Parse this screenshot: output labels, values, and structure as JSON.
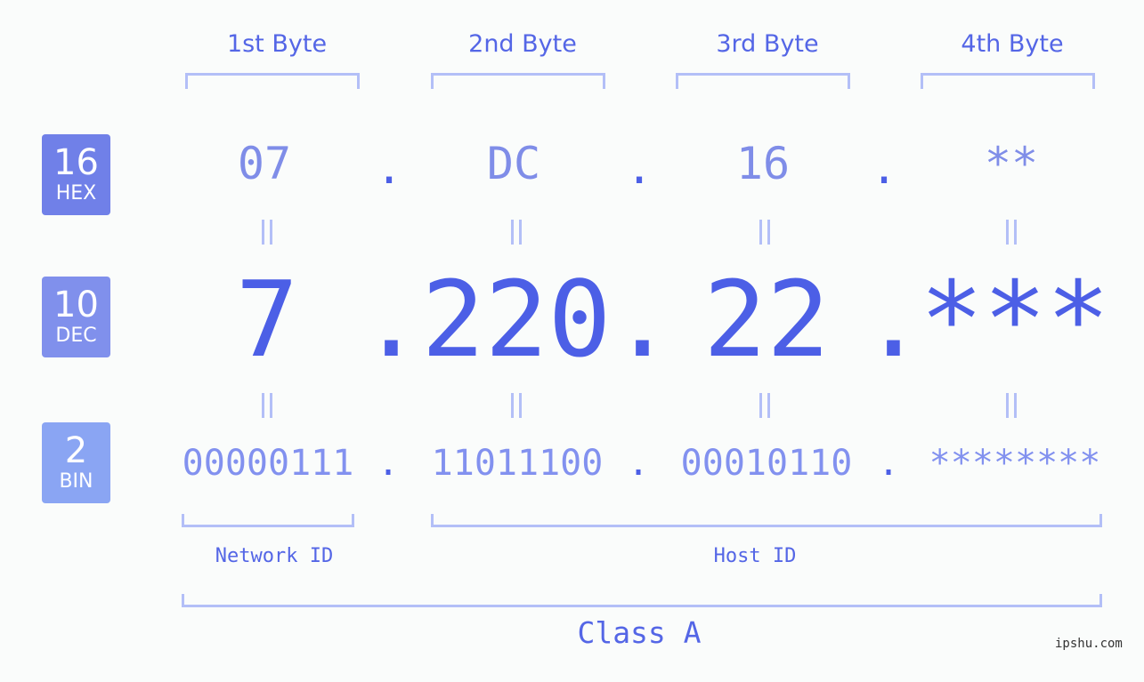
{
  "colors": {
    "accent": "#4c5fe6",
    "hex_badge": "#7080e8",
    "dec_badge": "#8090ec",
    "bin_badge": "#8aa5f3",
    "bracket": "#b3bff7"
  },
  "badges": [
    {
      "number": "16",
      "label": "HEX"
    },
    {
      "number": "10",
      "label": "DEC"
    },
    {
      "number": "2",
      "label": "BIN"
    }
  ],
  "byte_headers": [
    "1st Byte",
    "2nd Byte",
    "3rd Byte",
    "4th Byte"
  ],
  "separator": ".",
  "hex": [
    "07",
    "DC",
    "16",
    "**"
  ],
  "dec": [
    "7",
    "220",
    "22",
    "***"
  ],
  "bin": [
    "00000111",
    "11011100",
    "00010110",
    "********"
  ],
  "groups": {
    "network_id": "Network ID",
    "host_id": "Host ID",
    "class": "Class A"
  },
  "credit": "ipshu.com"
}
